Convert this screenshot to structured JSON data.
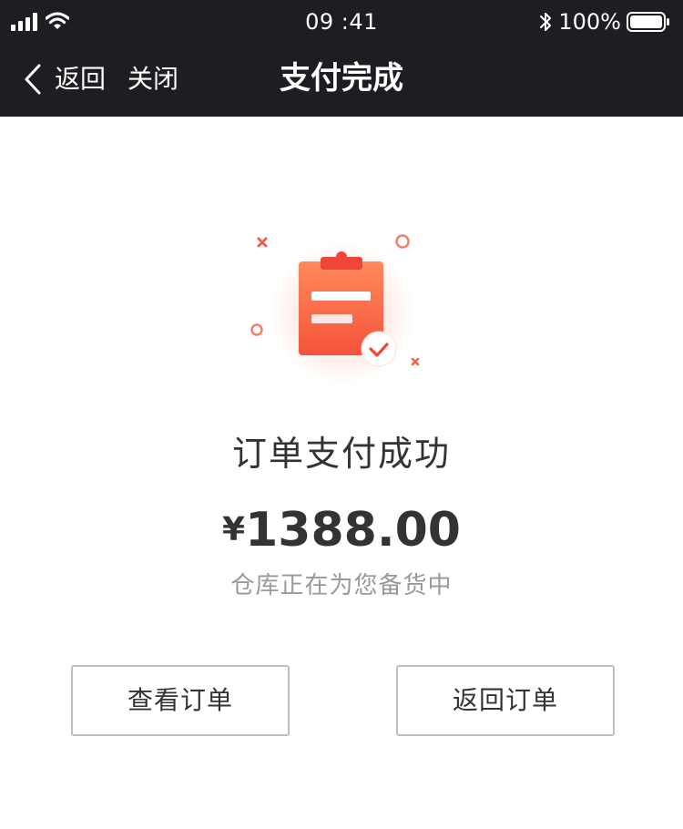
{
  "status_bar": {
    "time": "09 :41",
    "battery_percent": "100%",
    "icons": [
      "signal-icon",
      "wifi-icon",
      "bluetooth-icon",
      "battery-icon"
    ]
  },
  "nav": {
    "back_label": "返回",
    "close_label": "关闭",
    "title": "支付完成"
  },
  "result": {
    "icon": "clipboard-check-icon",
    "title": "订单支付成功",
    "currency_symbol": "¥",
    "amount": "1388.00",
    "subtitle": "仓库正在为您备货中"
  },
  "actions": {
    "view_order_label": "查看订单",
    "return_order_label": "返回订单"
  },
  "colors": {
    "top_bar_background": "#1e1e22",
    "accent_gradient_start": "#ff8a5c",
    "accent_gradient_end": "#f4533b",
    "text_primary": "#333333",
    "text_secondary": "#999999",
    "button_border": "#bfbfbf"
  }
}
